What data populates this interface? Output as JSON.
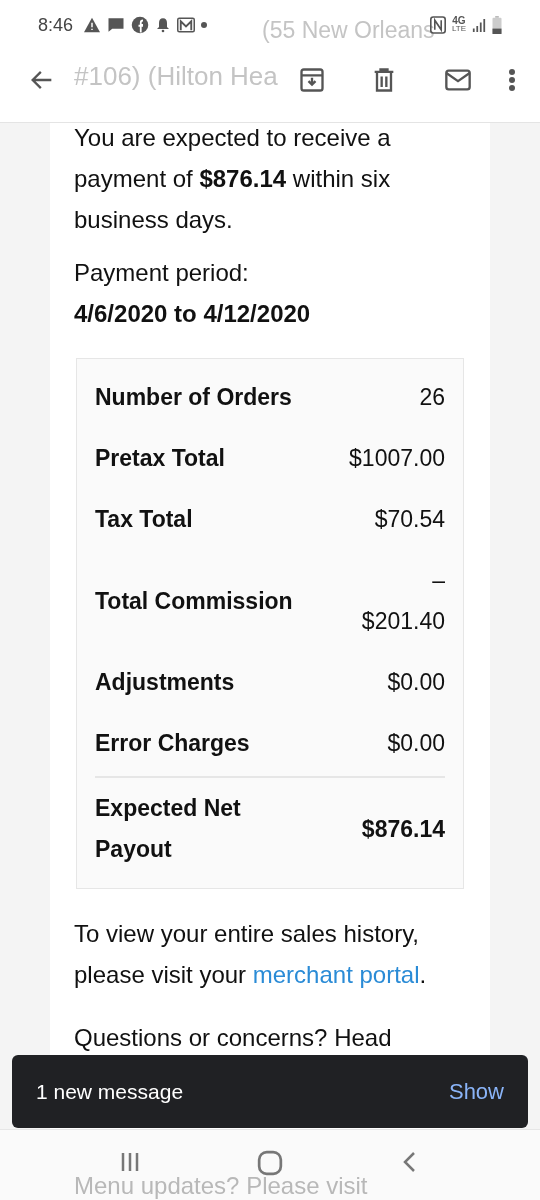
{
  "status_bar": {
    "time": "8:46",
    "network": "4G",
    "network_sub": "LTE"
  },
  "faded_title": [
    "(55 New Orleans",
    "#106) (Hilton Hea"
  ],
  "email": {
    "intro": "You are expected to receive a payment of **$876.14** within six business days.",
    "period_label": "Payment period:",
    "period": "4/6/2020 to 4/12/2020",
    "summary": [
      {
        "label": "Number of Orders",
        "value": "26",
        "kind": "row"
      },
      {
        "label": "Pretax Total",
        "value": "$1007.00",
        "kind": "row"
      },
      {
        "label": "Tax Total",
        "value": "$70.54",
        "kind": "row"
      },
      {
        "label": "Total Commission",
        "value": "– $201.40",
        "kind": "row"
      },
      {
        "label": "Adjustments",
        "value": "$0.00",
        "kind": "row"
      },
      {
        "label": "Error Charges",
        "value": "$0.00",
        "kind": "row"
      },
      {
        "label": "Expected Net Payout",
        "value": "$876.14",
        "kind": "total"
      }
    ],
    "history_text": "To view your entire sales history, please visit your ",
    "history_link": "merchant portal",
    "history_end": ".",
    "questions": "Questions or concerns? Head"
  },
  "snackbar": {
    "message": "1 new message",
    "action": "Show"
  },
  "faded_footer": "Menu updates? Please visit"
}
